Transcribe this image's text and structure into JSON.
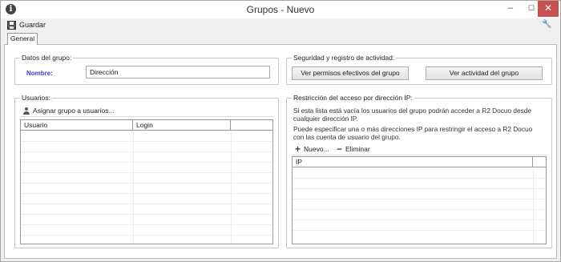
{
  "window": {
    "title": "Grupos - Nuevo",
    "info_icon": "info-icon",
    "controls": {
      "minimize": "–",
      "maximize": "☐",
      "close": "✕"
    }
  },
  "toolbar": {
    "save_label": "Guardar",
    "save_icon": "save-icon",
    "settings_icon": "wrench-icon"
  },
  "tabs": [
    {
      "label": "General",
      "active": true
    }
  ],
  "group_data": {
    "legend": "Datos del grupo:",
    "name_label": "Nombre:",
    "name_value": "Dirección"
  },
  "security": {
    "legend": "Seguridad y registro de actividad:",
    "permissions_button": "Ver permisos efectivos del grupo",
    "activity_button": "Ver actividad del grupo"
  },
  "users": {
    "legend": "Usuarios:",
    "assign_action": "Asignar grupo a usuarios...",
    "columns": [
      "Usuario",
      "Login",
      ""
    ],
    "rows": []
  },
  "ip_restriction": {
    "legend": "Restricción del acceso por dirección IP:",
    "info_1": "Si esta lista está vacía los usuarios del grupo podrán acceder a R2 Docuo desde cualquier dirección IP.",
    "info_2": "Puede especificar una o más direcciones IP para restringir el acceso a R2 Docuo con las cuenta de usuario del grupo.",
    "new_action": "Nuevo...",
    "delete_action": "Eliminar",
    "columns": [
      "IP",
      ""
    ],
    "rows": []
  },
  "colors": {
    "label_accent": "#3344cc",
    "close_button": "#c75050"
  }
}
